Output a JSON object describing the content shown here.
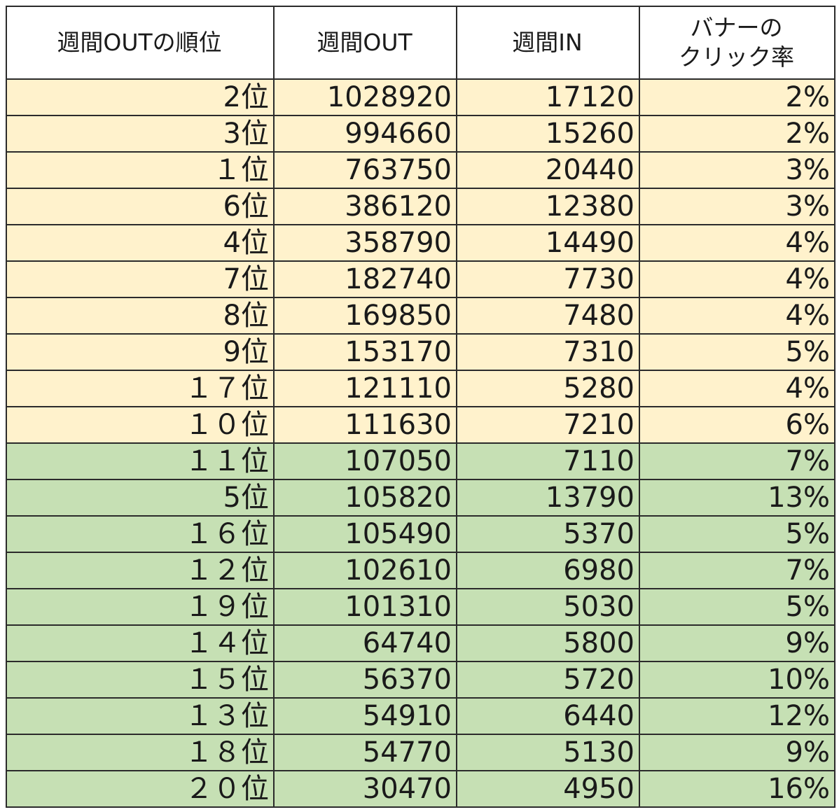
{
  "columns": [
    "週間OUTの順位",
    "週間OUT",
    "週間IN"
  ],
  "last_column": {
    "line1": "バナーの",
    "line2": "クリック率"
  },
  "colors": {
    "top_group_bg": "#fff2cc",
    "bottom_group_bg": "#c6e0b4",
    "border": "#2b2b2b"
  },
  "rows": [
    {
      "rank": "2位",
      "out": "1028920",
      "in": "17120",
      "ctr": "2%",
      "group": "top"
    },
    {
      "rank": "3位",
      "out": "994660",
      "in": "15260",
      "ctr": "2%",
      "group": "top"
    },
    {
      "rank": "１位",
      "out": "763750",
      "in": "20440",
      "ctr": "3%",
      "group": "top"
    },
    {
      "rank": "6位",
      "out": "386120",
      "in": "12380",
      "ctr": "3%",
      "group": "top"
    },
    {
      "rank": "4位",
      "out": "358790",
      "in": "14490",
      "ctr": "4%",
      "group": "top"
    },
    {
      "rank": "7位",
      "out": "182740",
      "in": "7730",
      "ctr": "4%",
      "group": "top"
    },
    {
      "rank": "8位",
      "out": "169850",
      "in": "7480",
      "ctr": "4%",
      "group": "top"
    },
    {
      "rank": "9位",
      "out": "153170",
      "in": "7310",
      "ctr": "5%",
      "group": "top"
    },
    {
      "rank": "１７位",
      "out": "121110",
      "in": "5280",
      "ctr": "4%",
      "group": "top"
    },
    {
      "rank": "１０位",
      "out": "111630",
      "in": "7210",
      "ctr": "6%",
      "group": "top"
    },
    {
      "rank": "１１位",
      "out": "107050",
      "in": "7110",
      "ctr": "7%",
      "group": "bottom"
    },
    {
      "rank": "5位",
      "out": "105820",
      "in": "13790",
      "ctr": "13%",
      "group": "bottom"
    },
    {
      "rank": "１６位",
      "out": "105490",
      "in": "5370",
      "ctr": "5%",
      "group": "bottom"
    },
    {
      "rank": "１２位",
      "out": "102610",
      "in": "6980",
      "ctr": "7%",
      "group": "bottom"
    },
    {
      "rank": "１９位",
      "out": "101310",
      "in": "5030",
      "ctr": "5%",
      "group": "bottom"
    },
    {
      "rank": "１４位",
      "out": "64740",
      "in": "5800",
      "ctr": "9%",
      "group": "bottom"
    },
    {
      "rank": "１５位",
      "out": "56370",
      "in": "5720",
      "ctr": "10%",
      "group": "bottom"
    },
    {
      "rank": "１３位",
      "out": "54910",
      "in": "6440",
      "ctr": "12%",
      "group": "bottom"
    },
    {
      "rank": "１８位",
      "out": "54770",
      "in": "5130",
      "ctr": "9%",
      "group": "bottom"
    },
    {
      "rank": "２０位",
      "out": "30470",
      "in": "4950",
      "ctr": "16%",
      "group": "bottom"
    }
  ]
}
